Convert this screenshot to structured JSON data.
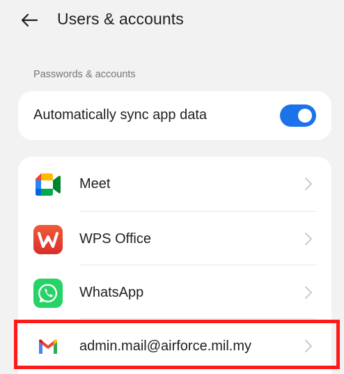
{
  "header": {
    "title": "Users & accounts",
    "back_icon": "back-arrow-icon"
  },
  "section": {
    "label": "Passwords & accounts"
  },
  "sync": {
    "label": "Automatically sync app data",
    "enabled": true,
    "toggle_color": "#1a73e8"
  },
  "accounts": [
    {
      "label": "Meet",
      "icon": "google-meet-icon"
    },
    {
      "label": "WPS Office",
      "icon": "wps-office-icon"
    },
    {
      "label": "WhatsApp",
      "icon": "whatsapp-icon"
    },
    {
      "label": "admin.mail@airforce.mil.my",
      "icon": "gmail-icon"
    }
  ],
  "colors": {
    "background": "#f2f2f2",
    "card": "#ffffff",
    "highlight_border": "#ff1a1a",
    "whatsapp": "#25d366",
    "wps": "#e8412c"
  }
}
